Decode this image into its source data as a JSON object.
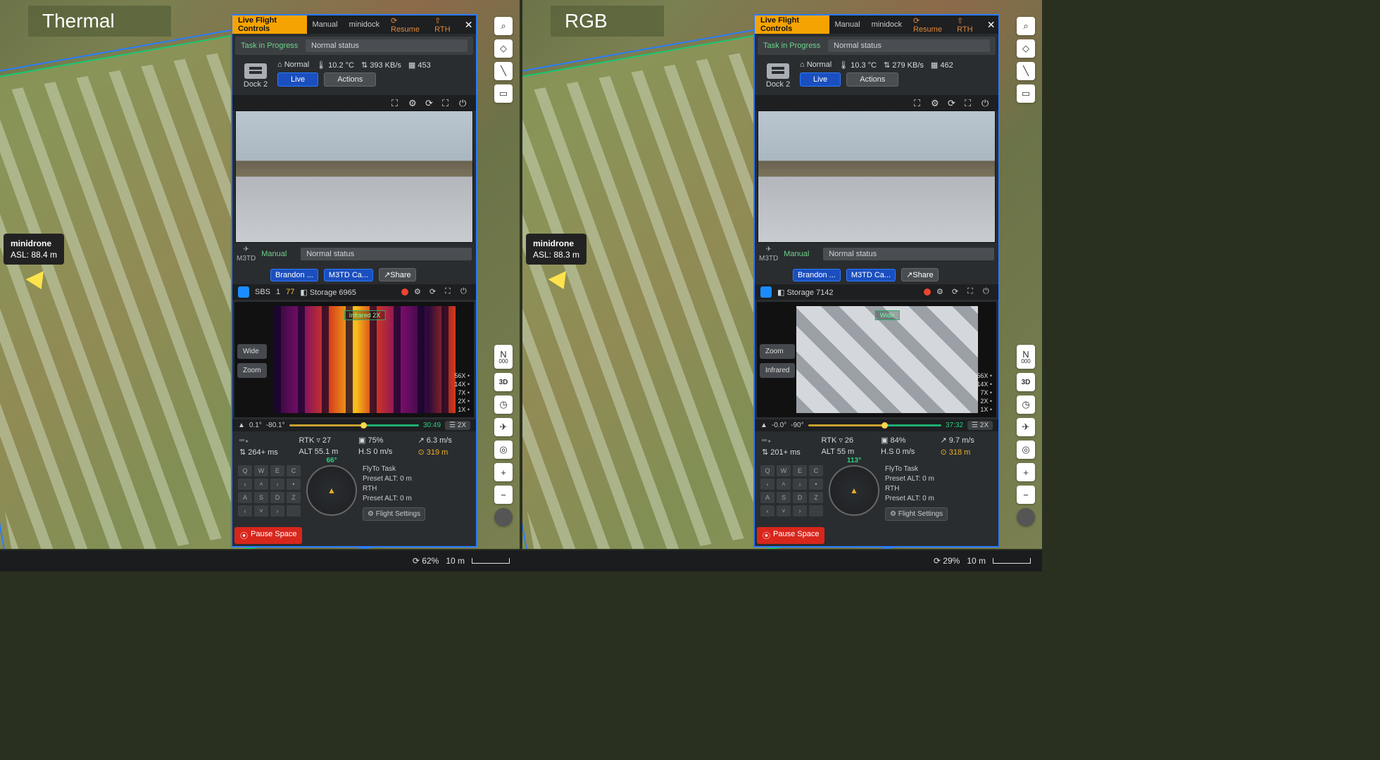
{
  "views": [
    {
      "title": "Thermal",
      "marker": {
        "name": "minidrone",
        "asl": "ASL: 88.4 m"
      },
      "panel": {
        "tabs": {
          "active": "Live Flight Controls",
          "t2": "Manual",
          "t3": "minidock",
          "u1": "⟳ Resume",
          "u2": "⇧ RTH"
        },
        "task": "Task in Progress",
        "status1": "Normal status",
        "dock": "Dock 2",
        "mode": "⌂ Normal",
        "temp": "🌡 10.2 °C",
        "rate": "⇅ 393 KB/s",
        "count": "▦ 453",
        "live": "Live",
        "actions": "Actions",
        "sub": {
          "mode": "Manual",
          "status": "Normal status",
          "model": "M3TD",
          "pilot": "Brandon ...",
          "cam": "M3TD Ca...",
          "share": "↗Share"
        },
        "storage": {
          "sbs": "SBS",
          "n1": "1",
          "n2": "77",
          "label": "◧ Storage 6965"
        },
        "feed": {
          "type": "thermal",
          "b1": "Wide",
          "b2": "Zoom",
          "overlay": "Infrared 2X",
          "zooms": [
            "56X",
            "14X",
            "7X",
            "2X",
            "1X"
          ]
        },
        "gimbal": {
          "a1": "0.1°",
          "a2": "-80.1°",
          "time": "30:49",
          "gx": "☰ 2X"
        },
        "telem": {
          "sig": "▫◦₊",
          "rtk": "RTK ▿ 27",
          "bat": "▣ 75%",
          "spd": "↗ 6.3 m/s",
          "lat": "⇅ 264+ ms",
          "alt": "ALT 55.1 m",
          "hs": "H.S 0 m/s",
          "dist": "⊙ 319 m"
        },
        "heading": "66°",
        "fly": {
          "t": "FlyTo Task",
          "p1": "Preset ALT: 0 m",
          "r": "RTH",
          "p2": "Preset ALT: 0 m",
          "fs": "⚙ Flight Settings"
        },
        "pause": "Pause Space"
      },
      "footer": {
        "pct": "⟳ 62%",
        "scale": "10 m"
      }
    },
    {
      "title": "RGB",
      "marker": {
        "name": "minidrone",
        "asl": "ASL: 88.3 m"
      },
      "panel": {
        "tabs": {
          "active": "Live Flight Controls",
          "t2": "Manual",
          "t3": "minidock",
          "u1": "⟳ Resume",
          "u2": "⇧ RTH"
        },
        "task": "Task in Progress",
        "status1": "Normal status",
        "dock": "Dock 2",
        "mode": "⌂ Normal",
        "temp": "🌡 10.3 °C",
        "rate": "⇅ 279 KB/s",
        "count": "▦ 462",
        "live": "Live",
        "actions": "Actions",
        "sub": {
          "mode": "Manual",
          "status": "Normal status",
          "model": "M3TD",
          "pilot": "Brandon ...",
          "cam": "M3TD Ca...",
          "share": "↗Share"
        },
        "storage": {
          "sbs": "",
          "n1": "",
          "n2": "",
          "label": "◧ Storage 7142"
        },
        "feed": {
          "type": "rgb",
          "b1": "Zoom",
          "b2": "Infrared",
          "overlay": "Wide",
          "zooms": [
            "56X",
            "14X",
            "7X",
            "2X",
            "1X"
          ]
        },
        "gimbal": {
          "a1": "-0.0°",
          "a2": "-90°",
          "time": "37:32",
          "gx": "☰ 2X"
        },
        "telem": {
          "sig": "▫◦₊",
          "rtk": "RTK ▿ 26",
          "bat": "▣ 84%",
          "spd": "↗ 9.7 m/s",
          "lat": "⇅ 201+ ms",
          "alt": "ALT 55 m",
          "hs": "H.S 0 m/s",
          "dist": "⊙ 318 m"
        },
        "heading": "113°",
        "fly": {
          "t": "FlyTo Task",
          "p1": "Preset ALT: 0 m",
          "r": "RTH",
          "p2": "Preset ALT: 0 m",
          "fs": "⚙ Flight Settings"
        },
        "pause": "Pause Space"
      },
      "footer": {
        "pct": "⟳ 29%",
        "scale": "10 m"
      }
    }
  ],
  "maptools": [
    "⌕",
    "◇",
    "╲",
    "▭"
  ],
  "rightTools": {
    "n": "N",
    "ndeg": "000",
    "d3": "3D",
    "clock": "◷",
    "plane": "✈",
    "target": "◎",
    "plus": "+",
    "minus": "−"
  },
  "keys": [
    "Q",
    "W",
    "E",
    "C",
    "",
    "",
    "",
    "",
    "A",
    "S",
    "D",
    "Z"
  ]
}
